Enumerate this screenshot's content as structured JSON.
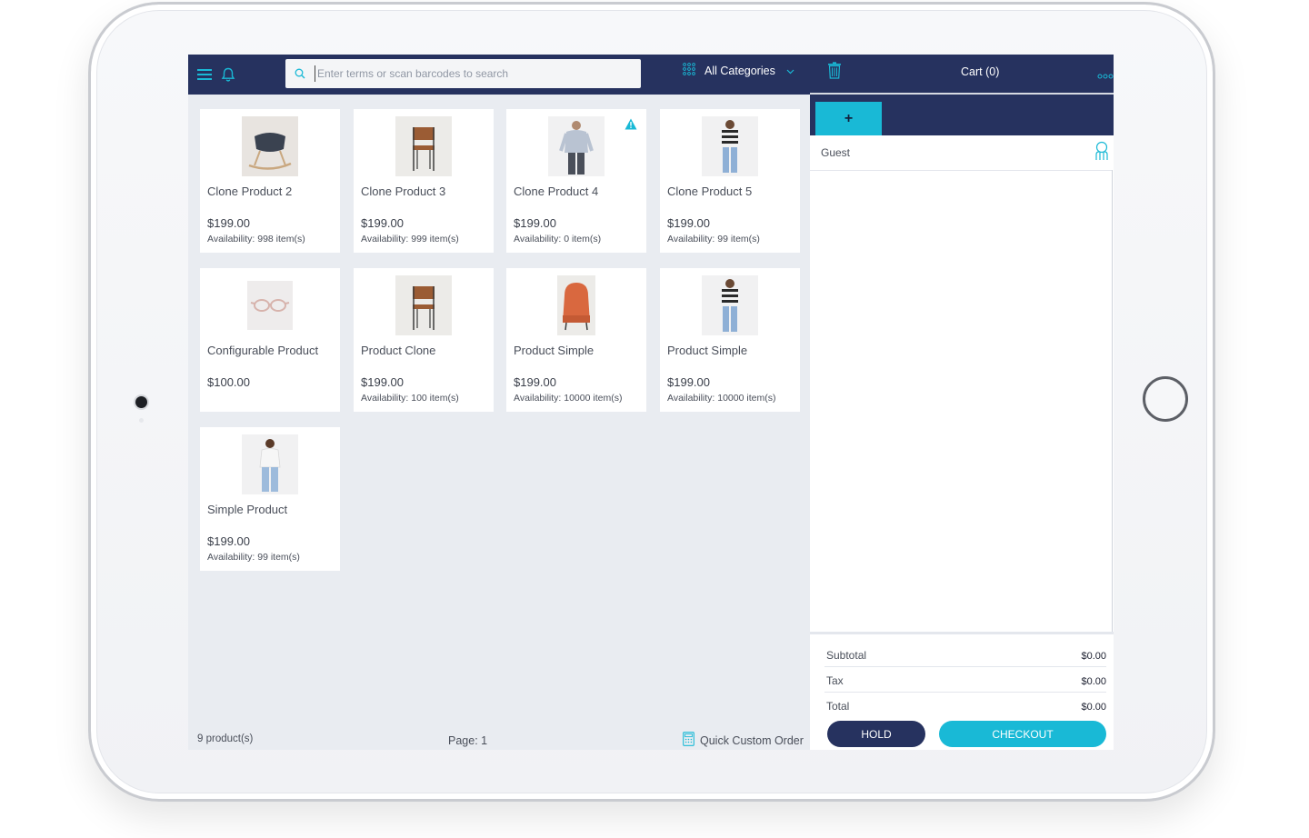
{
  "header": {
    "search_placeholder": "Enter terms or scan barcodes to search",
    "category_label": "All Categories",
    "cart_title": "Cart (0)"
  },
  "products": [
    {
      "name": "Clone Product 2",
      "price": "$199.00",
      "availability": "Availability: 998 item(s)",
      "image": "rocking-chair",
      "warning": false
    },
    {
      "name": "Clone Product 3",
      "price": "$199.00",
      "availability": "Availability: 999 item(s)",
      "image": "leather-chair",
      "warning": false
    },
    {
      "name": "Clone Product 4",
      "price": "$199.00",
      "availability": "Availability: 0 item(s)",
      "image": "man-sweater",
      "warning": true
    },
    {
      "name": "Clone Product 5",
      "price": "$199.00",
      "availability": "Availability: 99 item(s)",
      "image": "woman-striped-top",
      "warning": false
    },
    {
      "name": "Configurable Product",
      "price": "$100.00",
      "availability": "",
      "image": "glasses",
      "warning": false
    },
    {
      "name": "Product Clone",
      "price": "$199.00",
      "availability": "Availability: 100 item(s)",
      "image": "leather-chair",
      "warning": false
    },
    {
      "name": "Product Simple",
      "price": "$199.00",
      "availability": "Availability: 10000 item(s)",
      "image": "orange-armchair",
      "warning": false
    },
    {
      "name": "Product Simple",
      "price": "$199.00",
      "availability": "Availability: 10000 item(s)",
      "image": "woman-striped-top",
      "warning": false
    },
    {
      "name": "Simple Product",
      "price": "$199.00",
      "availability": "Availability: 99 item(s)",
      "image": "woman-white-top",
      "warning": false
    }
  ],
  "footer": {
    "count": "9 product(s)",
    "page": "Page: 1",
    "quick_order": "Quick Custom Order"
  },
  "cart": {
    "add_tab_label": "+",
    "customer": "Guest",
    "subtotal_label": "Subtotal",
    "subtotal_value": "$0.00",
    "tax_label": "Tax",
    "tax_value": "$0.00",
    "total_label": "Total",
    "total_value": "$0.00",
    "hold_label": "HOLD",
    "checkout_label": "CHECKOUT"
  },
  "colors": {
    "navy": "#26325f",
    "accent": "#19b9d6",
    "background": "#e9ecf1"
  }
}
